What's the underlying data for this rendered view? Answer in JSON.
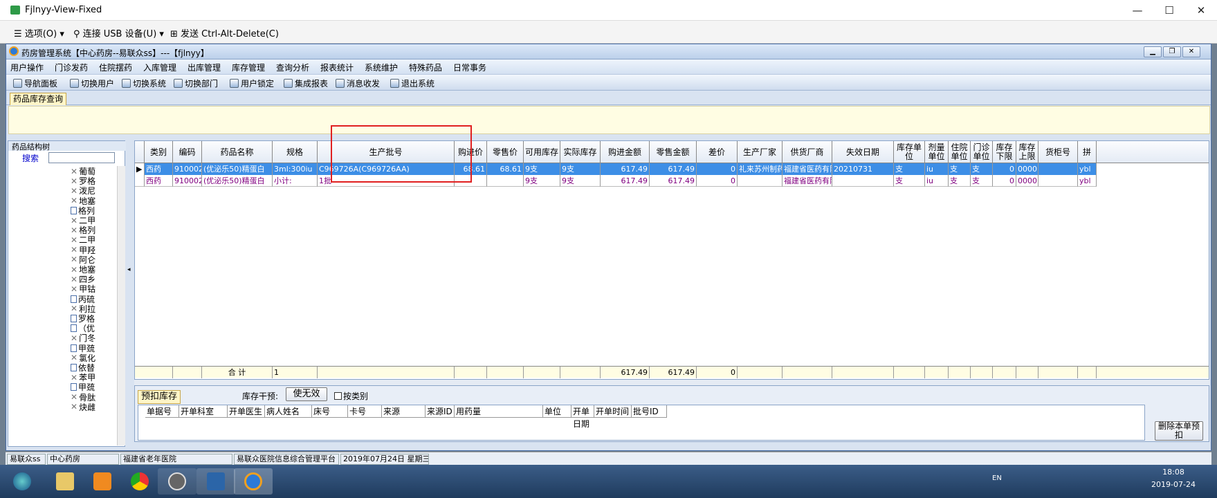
{
  "viewer": {
    "title": "Fjlnyy-View-Fixed",
    "options": "选项(O)",
    "usb": "连接 USB 设备(U)",
    "cad": "发送 Ctrl-Alt-Delete(C)"
  },
  "app": {
    "title": "药房管理系统【中心药房--易联众ss】---【fjlnyy】",
    "menu": [
      "用户操作",
      "门诊发药",
      "住院摆药",
      "入库管理",
      "出库管理",
      "库存管理",
      "查询分析",
      "报表统计",
      "系统维护",
      "特殊药品",
      "日常事务"
    ],
    "toolbar": [
      "导航面板",
      "切换用户",
      "切换系统",
      "切换部门",
      "用户锁定",
      "集成报表",
      "消息收发",
      "退出系统"
    ],
    "tab": "药品库存查询"
  },
  "tree": {
    "header": "药品结构树",
    "search_label": "搜索",
    "items": [
      "葡萄",
      "罗格",
      "泼尼",
      "地塞",
      "格列",
      "二甲",
      "格列",
      "二甲",
      "甲羟",
      "阿仑",
      "地塞",
      "四乡",
      "甲钴",
      "丙硫",
      "利拉",
      "罗格",
      "（优",
      "门冬",
      "甲巯",
      "氯化",
      "依替",
      "苯甲",
      "甲巯",
      "骨肽",
      "炔雌"
    ]
  },
  "grid": {
    "headers": [
      "类别",
      "编码",
      "药品名称",
      "规格",
      "生产批号",
      "购进价",
      "零售价",
      "可用库存",
      "实际库存",
      "购进金额",
      "零售金额",
      "差价",
      "生产厂家",
      "供货厂商",
      "失效日期",
      "库存单位",
      "剂量单位",
      "住院单位",
      "门诊单位",
      "库存下限",
      "库存上限",
      "货柜号",
      "拼"
    ],
    "rows": [
      [
        "西药",
        "9100026",
        "(优泌乐50)精蛋白",
        "3ml:300iu",
        "C969726A(C969726AA)",
        "68.61",
        "68.61",
        "9支",
        "9支",
        "617.49",
        "617.49",
        "0",
        "礼来苏州制药有限",
        "福建省医药有限",
        "20210731",
        "支",
        "iu",
        "支",
        "支",
        "0",
        "0000",
        "",
        "ybl"
      ],
      [
        "西药",
        "9100026",
        "(优泌乐50)精蛋白",
        "小计:",
        "1批",
        "",
        "",
        "9支",
        "9支",
        "617.49",
        "617.49",
        "0",
        "",
        "福建省医药有限",
        "",
        "支",
        "iu",
        "支",
        "支",
        "0",
        "0000",
        "",
        "ybl"
      ]
    ],
    "total": {
      "label": "合  计",
      "spec": "1",
      "buy": "617.49",
      "retail": "617.49",
      "diff": "0"
    }
  },
  "bottom": {
    "tab": "预扣库存",
    "intervene_label": "库存干预:",
    "invalidate": "使无效",
    "by_category": "按类别",
    "delete_btn": "删除本单预扣",
    "headers": [
      "单据号",
      "开单科室",
      "开单医生",
      "病人姓名",
      "床号",
      "卡号",
      "来源",
      "来源ID",
      "用药量",
      "单位",
      "开单日期",
      "开单时间",
      "批号ID"
    ]
  },
  "status": [
    "易联众ss",
    "中心药房",
    "福建省老年医院",
    "易联众医院信息综合管理平台",
    "2019年07月24日 星期三"
  ],
  "clock": {
    "time": "18:08",
    "date": "2019-07-24",
    "lang": "EN"
  },
  "colors": {
    "selected": "#3d8ee6",
    "highlight_box": "#e02020",
    "subtotal_text": "#800080"
  }
}
